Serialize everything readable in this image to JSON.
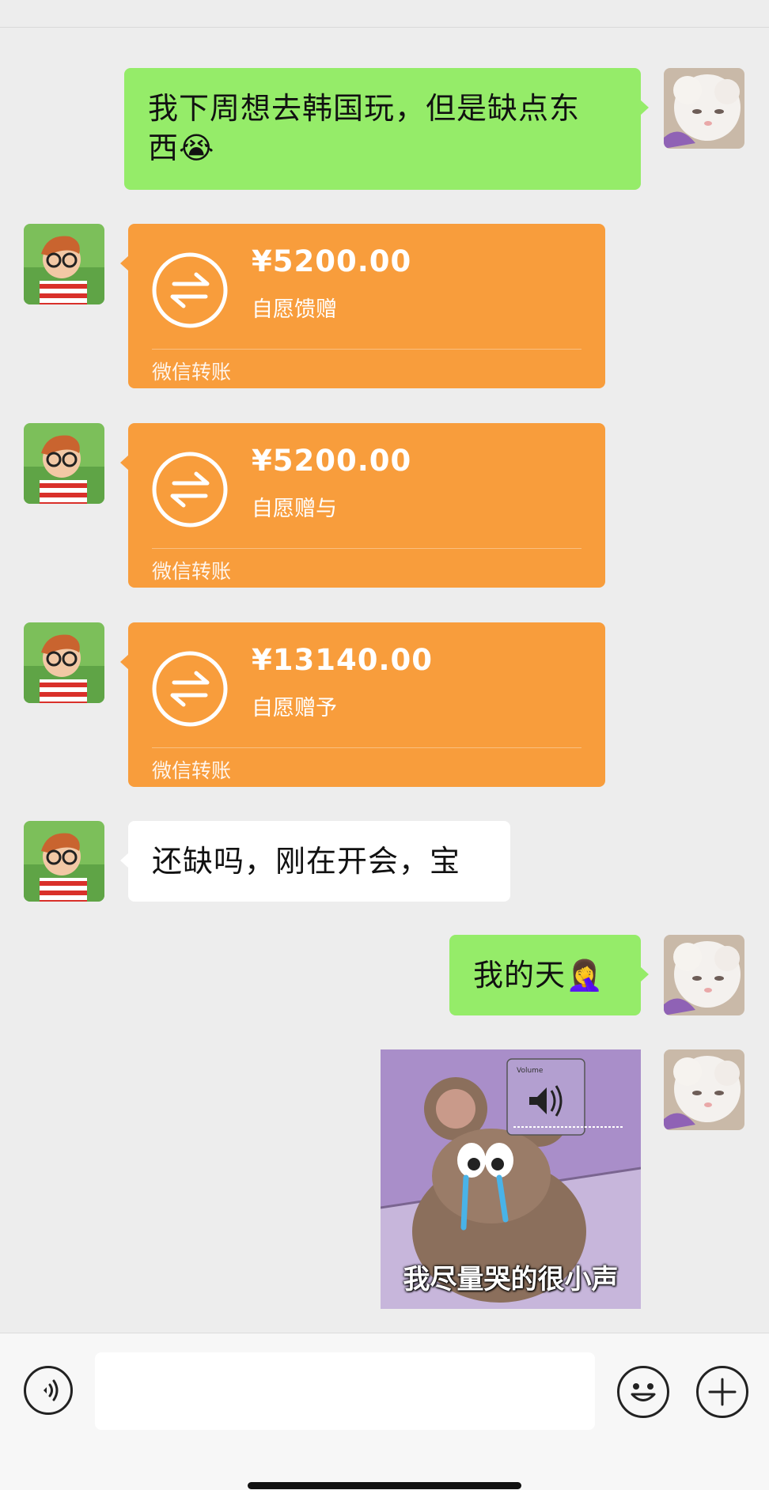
{
  "messages": {
    "m1": {
      "text": "我下周想去韩国玩，但是缺点东西😭",
      "line1": "我下周想去韩国玩，但是缺点东",
      "line2": "西😭"
    },
    "transfers": [
      {
        "amount": "¥5200.00",
        "note": "自愿馈赠",
        "source": "微信转账"
      },
      {
        "amount": "¥5200.00",
        "note": "自愿赠与",
        "source": "微信转账"
      },
      {
        "amount": "¥13140.00",
        "note": "自愿赠予",
        "source": "微信转账"
      }
    ],
    "m5": {
      "text": "还缺吗，刚在开会，宝"
    },
    "m6": {
      "text": "我的天🤦‍♀️"
    },
    "sticker": {
      "caption": "我尽量哭的很小声",
      "volume_label": "Volume"
    }
  },
  "input_bar": {
    "placeholder": "",
    "voice_icon": "voice-icon",
    "emoji_icon": "emoji-icon",
    "plus_icon": "plus-icon"
  },
  "colors": {
    "bg": "#ededed",
    "green_bubble": "#95ec69",
    "transfer_orange": "#f89d3c"
  }
}
